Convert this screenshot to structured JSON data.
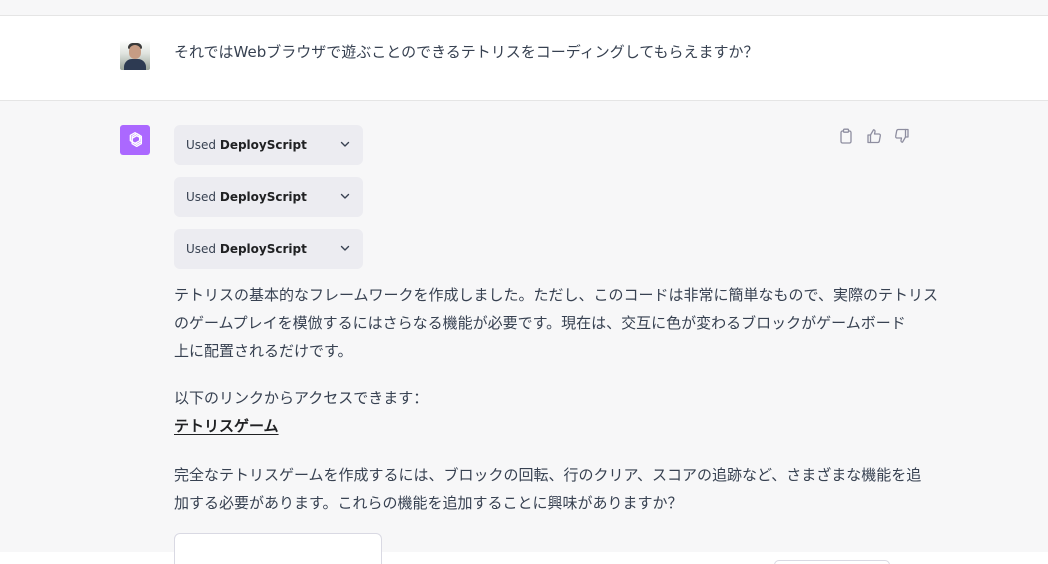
{
  "user": {
    "message": "それではWebブラウザで遊ぶことのできるテトリスをコーディングしてもらえますか？"
  },
  "assistant": {
    "tools": [
      {
        "prefix": "Used ",
        "name": "DeployScript"
      },
      {
        "prefix": "Used ",
        "name": "DeployScript"
      },
      {
        "prefix": "Used ",
        "name": "DeployScript"
      }
    ],
    "paragraph1": [
      "テトリスの基本的なフレームワークを作成しました。ただし、このコードは非常に簡単なもので、実際のテトリス",
      "のゲームプレイを模倣するにはさらなる機能が必要です。現在は、交互に色が変わるブロックがゲームボード",
      "上に配置されるだけです。"
    ],
    "link_intro": "以下のリンクからアクセスできます：",
    "link_text": "テトリスゲーム",
    "paragraph2": [
      "完全なテトリスゲームを作成するには、ブロックの回転、行のクリア、スコアの追跡など、さまざまな機能を追",
      "加する必要があります。これらの機能を追加することに興味がありますか？"
    ]
  },
  "icons": {
    "tool_chevron": "chevron-down-icon",
    "copy": "clipboard-icon",
    "like": "thumbs-up-icon",
    "dislike": "thumbs-down-icon",
    "bot": "openai-logo-icon"
  },
  "colors": {
    "bot_avatar": "#ab68ff",
    "chip_bg": "#ececf1",
    "assistant_bg": "#f7f7f8",
    "text": "#374151"
  }
}
